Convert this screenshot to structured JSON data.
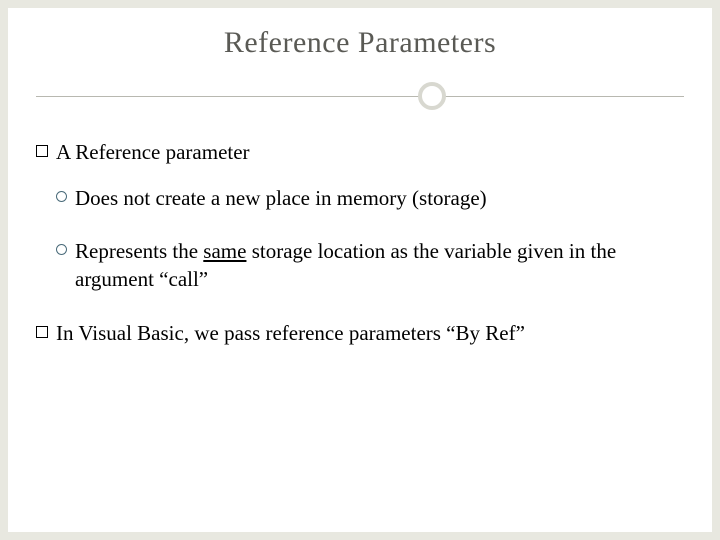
{
  "slide": {
    "title": "Reference Parameters",
    "bullets": [
      {
        "text": "A Reference parameter",
        "children": [
          {
            "text": "Does not create a new place in memory (storage)"
          },
          {
            "pre": "Represents the ",
            "u": "same",
            "post": " storage location as the variable given in the argument “call”"
          }
        ]
      },
      {
        "text": "In Visual Basic, we pass reference parameters “By Ref”"
      }
    ]
  }
}
